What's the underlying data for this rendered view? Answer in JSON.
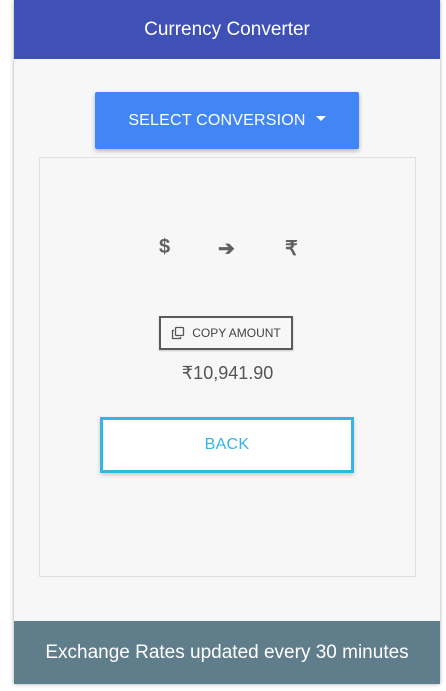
{
  "header": {
    "title": "Currency Converter"
  },
  "select_button": {
    "label": "SELECT CONVERSION",
    "icon": "caret-down-icon"
  },
  "conversion": {
    "from_symbol": "$",
    "arrow_symbol": "➔",
    "to_symbol": "₹"
  },
  "copy_button": {
    "label": "COPY AMOUNT",
    "icon": "copy-icon"
  },
  "result": {
    "amount": "₹10,941.90"
  },
  "back_button": {
    "label": "BACK"
  },
  "footer": {
    "text": "Exchange Rates updated every 30 minutes"
  },
  "colors": {
    "header": "#3f51b5",
    "primary_button": "#4285f4",
    "back_button_accent": "#33b5e5",
    "footer": "#607d8b",
    "background": "#f7f7f7"
  }
}
